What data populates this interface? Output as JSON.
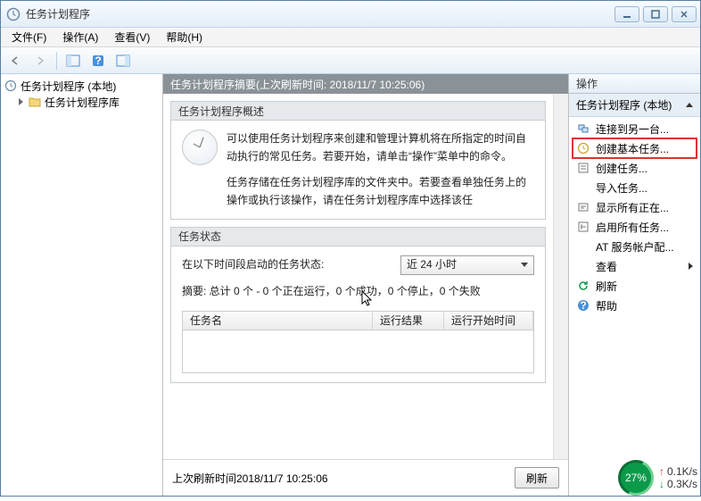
{
  "window": {
    "title": "任务计划程序"
  },
  "menu": {
    "file": "文件(F)",
    "action": "操作(A)",
    "view": "查看(V)",
    "help": "帮助(H)"
  },
  "tree": {
    "root": "任务计划程序 (本地)",
    "lib": "任务计划程序库"
  },
  "summary": {
    "header": "任务计划程序摘要(上次刷新时间: 2018/11/7 10:25:06)",
    "overview_title": "任务计划程序概述",
    "overview_body1": "可以使用任务计划程序来创建和管理计算机将在所指定的时间自动执行的常见任务。若要开始，请单击“操作”菜单中的命令。",
    "overview_body2": "任务存储在任务计划程序库的文件夹中。若要查看单独任务上的操作或执行该操作，请在任务计划程序库中选择该任",
    "status_title": "任务状态",
    "status_label": "在以下时间段启动的任务状态:",
    "status_combo": "近 24 小时",
    "status_summary": "摘要: 总计 0 个 - 0 个正在运行，0 个成功，0 个停止，0 个失败",
    "col_name": "任务名",
    "col_result": "运行结果",
    "col_start": "运行开始时间",
    "footer_label": "上次刷新时间2018/11/7 10:25:06",
    "refresh_btn": "刷新"
  },
  "actions": {
    "header": "操作",
    "group": "任务计划程序 (本地)",
    "items": [
      {
        "label": "连接到另一台...",
        "icon": "connect"
      },
      {
        "label": "创建基本任务...",
        "icon": "task-basic",
        "highlight": true
      },
      {
        "label": "创建任务...",
        "icon": "task"
      },
      {
        "label": "导入任务...",
        "icon": "import"
      },
      {
        "label": "显示所有正在...",
        "icon": "show-running"
      },
      {
        "label": "启用所有任务...",
        "icon": "enable-history"
      },
      {
        "label": "AT 服务帐户配...",
        "icon": "at-account"
      },
      {
        "label": "查看",
        "icon": "view",
        "submenu": true
      },
      {
        "label": "刷新",
        "icon": "refresh"
      },
      {
        "label": "帮助",
        "icon": "help"
      }
    ]
  },
  "net": {
    "percent": "27%",
    "up": "0.1K/s",
    "down": "0.3K/s"
  }
}
